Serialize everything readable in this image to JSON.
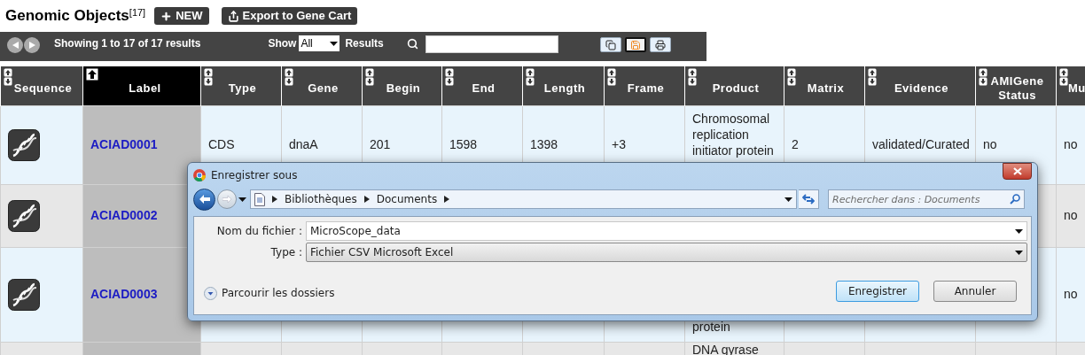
{
  "page": {
    "title": "Genomic Objects$^{[17]}$",
    "buttons": [
      {
        "kind": "new",
        "label": "NEW"
      },
      {
        "kind": "export",
        "label": "Export to Gene Cart"
      }
    ]
  },
  "toolbar": {
    "info": "Showing 1 to 17 of 17 results",
    "show_label": "Show",
    "page_size": "All",
    "results_label": "Results",
    "actions": [
      {
        "kind": "copy",
        "selected": false
      },
      {
        "kind": "save",
        "selected": true
      },
      {
        "kind": "print",
        "selected": false
      }
    ]
  },
  "table": {
    "columns": [
      {
        "label": "Sequence",
        "sorted": false
      },
      {
        "label": "Label",
        "sorted": true
      },
      {
        "label": "Type",
        "sorted": false
      },
      {
        "label": "Gene",
        "sorted": false
      },
      {
        "label": "Begin",
        "sorted": false
      },
      {
        "label": "End",
        "sorted": false
      },
      {
        "label": "Length",
        "sorted": false
      },
      {
        "label": "Frame",
        "sorted": false
      },
      {
        "label": "Product",
        "sorted": false
      },
      {
        "label": "Matrix",
        "sorted": false
      },
      {
        "label": "Evidence",
        "sorted": false
      },
      {
        "label": "AMIGene Status",
        "sorted": false
      },
      {
        "label": "Mu",
        "sorted": false
      }
    ],
    "rows": [
      {
        "label": "ACIAD0001",
        "type": "CDS",
        "gene": "dnaA",
        "begin": "201",
        "end": "1598",
        "length": "1398",
        "frame": "+3",
        "product": "Chromosomal replication initiator protein",
        "matrix": "2",
        "evidence": "validated/Curated",
        "amigene_status": "no",
        "column_13": "no"
      },
      {
        "label": "ACIAD0002",
        "column_13": "no"
      },
      {
        "label": "ACIAD0003",
        "product": "protein",
        "column_13": "no"
      },
      {
        "product": "DNA gyrase"
      }
    ]
  },
  "dialog": {
    "title": "Enregistrer sous",
    "path": [
      "Bibliothèques",
      "Documents"
    ],
    "search_placeholder": "Rechercher dans : Documents",
    "fields": [
      {
        "kind": "combo",
        "label": "Nom du fichier :",
        "value": "MicroScope_data"
      },
      {
        "kind": "select",
        "label": "Type :",
        "value": "Fichier CSV Microsoft Excel"
      }
    ],
    "browse_label": "Parcourir les dossiers",
    "buttons": [
      {
        "label": "Enregistrer",
        "default": true
      },
      {
        "label": "Annuler",
        "default": false
      }
    ]
  }
}
